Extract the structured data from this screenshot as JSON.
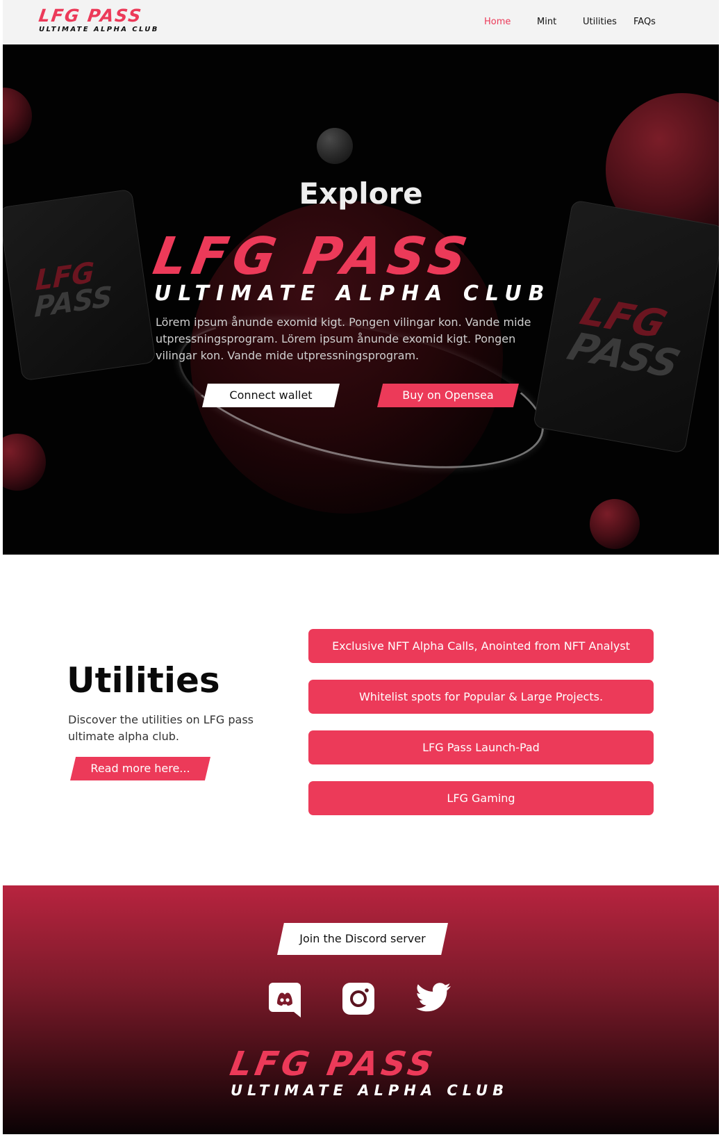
{
  "brand": {
    "logo_main": "LFG PASS",
    "logo_sub": "ULTIMATE ALPHA CLUB",
    "accent_color": "#ec3a59"
  },
  "nav": {
    "items": [
      {
        "label": "Home",
        "active": true
      },
      {
        "label": "Mint",
        "active": false
      },
      {
        "label": "Utilities",
        "active": false
      },
      {
        "label": "FAQs",
        "active": false
      }
    ]
  },
  "hero": {
    "title": "Explore",
    "logo_main": "LFG PASS",
    "logo_sub": "ULTIMATE ALPHA CLUB",
    "text": "Lörem ipsum ånunde exomid kigt. Pongen vilingar kon. Vande mide utpressningsprogram. Lörem ipsum ånunde exomid kigt. Pongen vilingar kon. Vande mide utpressningsprogram.",
    "connect_wallet": "Connect wallet",
    "buy_opensea": "Buy on Opensea",
    "card_logo_main": "LFG",
    "card_logo_sub": "PASS"
  },
  "utilities": {
    "title": "Utilities",
    "description": "Discover the utilities on LFG pass ultimate alpha club.",
    "read_more": "Read more here...",
    "items": [
      "Exclusive NFT Alpha Calls, Anointed from NFT Analyst",
      "Whitelist spots for Popular & Large Projects.",
      "LFG Pass Launch-Pad",
      "LFG Gaming"
    ]
  },
  "footer": {
    "discord_button": "Join the Discord server",
    "socials": [
      "discord-icon",
      "instagram-icon",
      "twitter-icon"
    ],
    "logo_main": "LFG PASS",
    "logo_sub": "ULTIMATE ALPHA CLUB"
  }
}
